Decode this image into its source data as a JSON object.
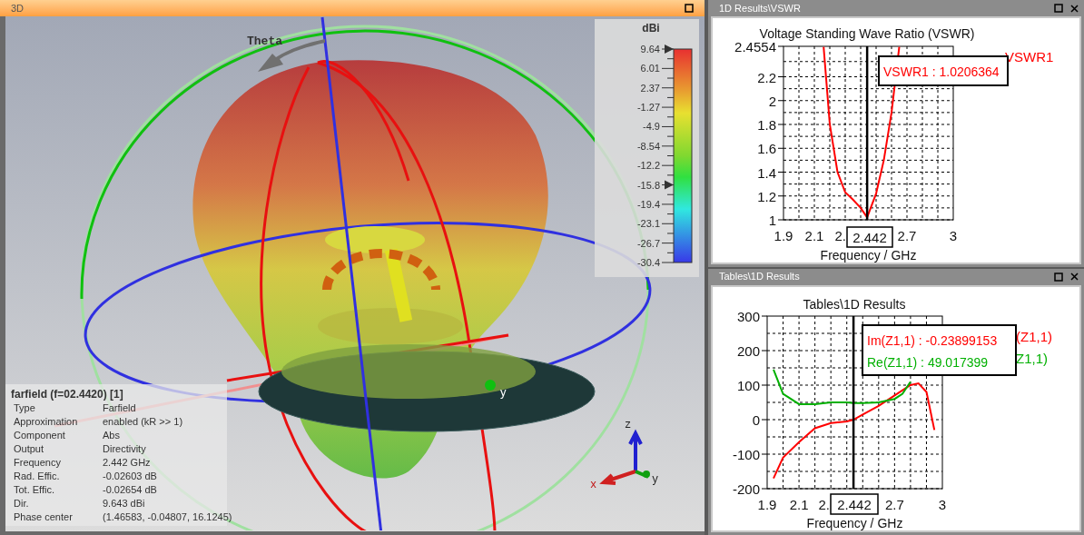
{
  "view3d": {
    "title": "3D",
    "theta_label": "Theta",
    "scene_axis_labels": [
      "y"
    ],
    "triad_labels": [
      "z",
      "x",
      "y"
    ],
    "legend": {
      "unit": "dBi",
      "ticks": [
        {
          "text": "9.64",
          "marker": true
        },
        {
          "text": "6.01",
          "marker": false
        },
        {
          "text": "2.37",
          "marker": false
        },
        {
          "text": "-1.27",
          "marker": false
        },
        {
          "text": "-4.9",
          "marker": false
        },
        {
          "text": "-8.54",
          "marker": false
        },
        {
          "text": "-12.2",
          "marker": false
        },
        {
          "text": "-15.8",
          "marker": true
        },
        {
          "text": "-19.4",
          "marker": false
        },
        {
          "text": "-23.1",
          "marker": false
        },
        {
          "text": "-26.7",
          "marker": false
        },
        {
          "text": "-30.4",
          "marker": false
        }
      ]
    },
    "info": {
      "title": "farfield (f=02.4420) [1]",
      "rows": [
        {
          "label": "Type",
          "value": "Farfield"
        },
        {
          "label": "Approximation",
          "value": "enabled (kR >> 1)"
        },
        {
          "label": "Component",
          "value": "Abs"
        },
        {
          "label": "Output",
          "value": "Directivity"
        },
        {
          "label": "Frequency",
          "value": "2.442 GHz"
        },
        {
          "label": "Rad. Effic.",
          "value": "-0.02603 dB"
        },
        {
          "label": "Tot. Effic.",
          "value": "-0.02654 dB"
        },
        {
          "label": "Dir.",
          "value": "9.643 dBi"
        },
        {
          "label": "Phase center",
          "value": "(1.46583, -0.04807, 16.1245)"
        }
      ]
    }
  },
  "panes": [
    {
      "title": "1D Results\\VSWR",
      "marker_readout": [
        {
          "text": "VSWR1 : 1.0206364",
          "color": "#ff0000"
        }
      ],
      "chart_data": {
        "type": "line",
        "title": "Voltage Standing Wave Ratio (VSWR)",
        "xlabel": "Frequency / GHz",
        "xlim": [
          1.9,
          3
        ],
        "ylim": [
          1,
          2.4554
        ],
        "xticks": [
          1.9,
          2.1,
          {
            "value": 2.3,
            "label": "2."
          },
          2.7,
          3
        ],
        "yticks": [
          1,
          1.2,
          1.4,
          1.6,
          1.8,
          2,
          2.2,
          {
            "value": 2.4554,
            "label": "2.4554"
          }
        ],
        "x": [
          2.16,
          2.2,
          2.25,
          2.3,
          2.35,
          2.4,
          2.442,
          2.5,
          2.55,
          2.6,
          2.65
        ],
        "series": [
          {
            "name": "VSWR1",
            "color": "#ff0000",
            "values": [
              2.45,
              1.8,
              1.4,
              1.23,
              1.17,
              1.1,
              1.02,
              1.22,
              1.5,
              1.9,
              2.45
            ]
          }
        ],
        "grid": true,
        "ref_lines": [
          {
            "axis": "x",
            "value": 2.442
          }
        ],
        "annotations": [
          "2.442"
        ]
      }
    },
    {
      "title": "Tables\\1D Results",
      "legend_labels": [
        {
          "text": "(Z1,1)",
          "color": "#ff0000"
        },
        {
          "text": "Z1,1)",
          "color": "#00b000"
        }
      ],
      "marker_readout": [
        {
          "text": "Im(Z1,1) : -0.23899153",
          "color": "#ff0000"
        },
        {
          "text": "Re(Z1,1) : 49.017399",
          "color": "#00b000"
        }
      ],
      "chart_data": {
        "type": "line",
        "title": "Tables\\1D Results",
        "xlabel": "Frequency / GHz",
        "xlim": [
          1.9,
          3
        ],
        "ylim": [
          -200,
          300
        ],
        "xticks": [
          1.9,
          2.1,
          {
            "value": 2.3,
            "label": "2."
          },
          2.7,
          3
        ],
        "yticks": [
          -200,
          -100,
          0,
          100,
          200,
          300
        ],
        "x": [
          1.94,
          2.0,
          2.1,
          2.2,
          2.3,
          2.4,
          2.442,
          2.5,
          2.6,
          2.7,
          2.75,
          2.8,
          2.85,
          2.9,
          2.95
        ],
        "series": [
          {
            "color": "#ff0000",
            "values": [
              -170,
              -110,
              -65,
              -25,
              -10,
              -5,
              0,
              15,
              40,
              70,
              85,
              100,
              105,
              80,
              -30
            ]
          },
          {
            "color": "#00b000",
            "values": [
              145,
              75,
              45,
              45,
              50,
              50,
              48,
              48,
              50,
              60,
              75,
              110,
              null,
              null,
              null
            ]
          }
        ],
        "grid": true,
        "ref_lines": [
          {
            "axis": "x",
            "value": 2.442
          }
        ],
        "annotations": [
          "2.442"
        ]
      }
    }
  ]
}
